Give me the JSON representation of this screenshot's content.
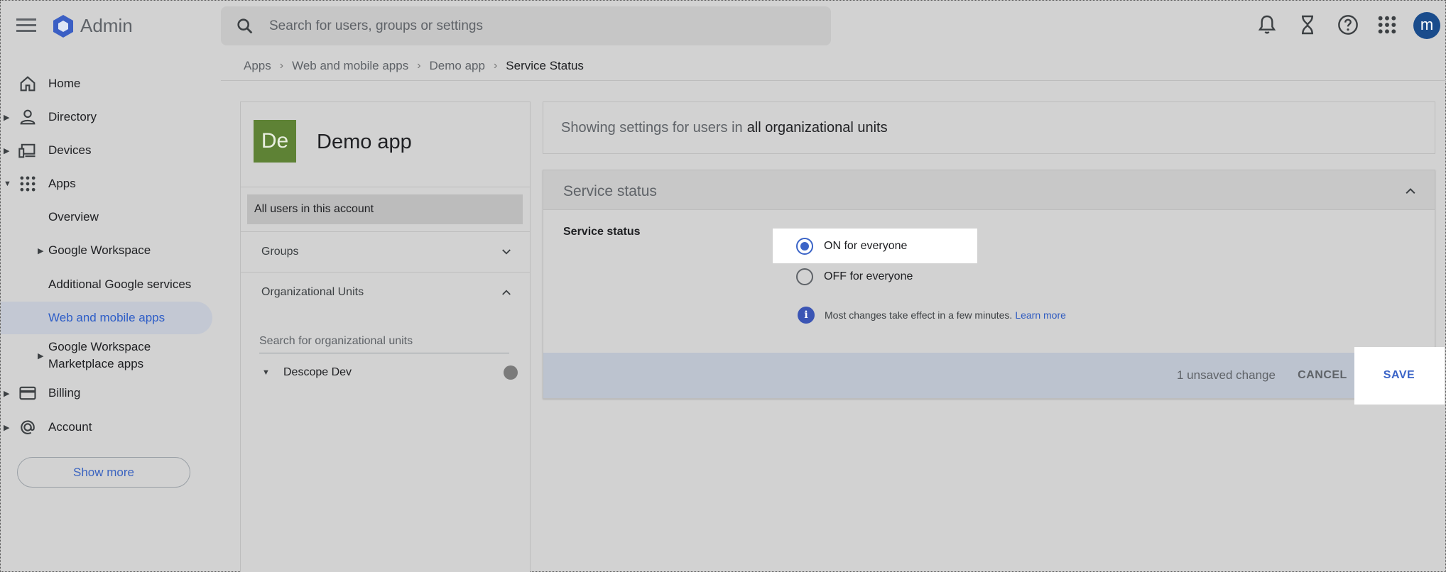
{
  "header": {
    "app_name": "Admin",
    "search_placeholder": "Search for users, groups or settings",
    "avatar_initial": "m",
    "icons": [
      "menu-icon",
      "admin-logo-icon",
      "search-icon",
      "notifications-icon",
      "tasks-icon",
      "help-icon",
      "apps-grid-icon"
    ]
  },
  "breadcrumb": {
    "items": [
      "Apps",
      "Web and mobile apps",
      "Demo app"
    ],
    "current": "Service Status"
  },
  "sidebar": {
    "items": [
      {
        "label": "Home",
        "icon": "home-icon"
      },
      {
        "label": "Directory",
        "icon": "person-icon"
      },
      {
        "label": "Devices",
        "icon": "devices-icon"
      },
      {
        "label": "Apps",
        "icon": "apps-icon"
      },
      {
        "label": "Overview"
      },
      {
        "label": "Google Workspace"
      },
      {
        "label": "Additional Google services"
      },
      {
        "label": "Web and mobile apps"
      },
      {
        "label": "Google Workspace Marketplace apps"
      },
      {
        "label": "Billing",
        "icon": "credit-card-icon"
      },
      {
        "label": "Account",
        "icon": "at-sign-icon"
      }
    ],
    "show_more": "Show more"
  },
  "app_panel": {
    "tile_initials": "De",
    "app_title": "Demo app",
    "all_users": "All users in this account",
    "groups_label": "Groups",
    "org_units_label": "Organizational Units",
    "ou_search_placeholder": "Search for organizational units",
    "ou_items": [
      "Descope Dev"
    ]
  },
  "scope": {
    "prefix": "Showing settings for users in",
    "value": "all organizational units"
  },
  "service_status": {
    "card_title": "Service status",
    "field_label": "Service status",
    "options": [
      "ON for everyone",
      "OFF for everyone"
    ],
    "selected": "ON for everyone",
    "info_text": "Most changes take effect in a few minutes.",
    "learn_more": "Learn more"
  },
  "footer": {
    "unsaved": "1 unsaved change",
    "cancel": "CANCEL",
    "save": "SAVE"
  },
  "colors": {
    "accent": "#3b64c7",
    "tile": "#5e8235",
    "avatar": "#1a4c8c"
  }
}
